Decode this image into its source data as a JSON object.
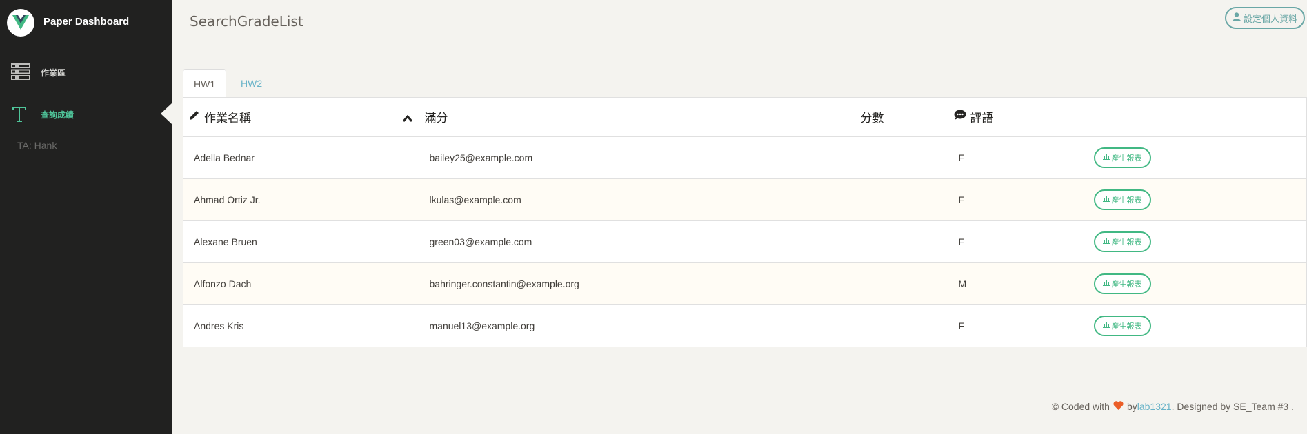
{
  "brand": {
    "name": "Paper Dashboard"
  },
  "sidebar": {
    "items": [
      {
        "label": "作業區",
        "icon": "list-icon",
        "active": false
      },
      {
        "label": "查詢成績",
        "icon": "text-t-icon",
        "active": true
      }
    ],
    "ta_label": "TA: Hank"
  },
  "header": {
    "title": "SearchGradeList",
    "profile_button": "設定個人資料"
  },
  "tabs": [
    {
      "label": "HW1",
      "active": true
    },
    {
      "label": "HW2",
      "active": false
    }
  ],
  "table": {
    "columns": [
      "作業名稱",
      "滿分",
      "分數",
      "評語",
      ""
    ],
    "rows": [
      {
        "name": "Adella Bednar",
        "email": "bailey25@example.com",
        "score": "",
        "comment": "F"
      },
      {
        "name": "Ahmad Ortiz Jr.",
        "email": "lkulas@example.com",
        "score": "",
        "comment": "F"
      },
      {
        "name": "Alexane Bruen",
        "email": "green03@example.com",
        "score": "",
        "comment": "F"
      },
      {
        "name": "Alfonzo Dach",
        "email": "bahringer.constantin@example.org",
        "score": "",
        "comment": "M"
      },
      {
        "name": "Andres Kris",
        "email": "manuel13@example.org",
        "score": "",
        "comment": "F"
      }
    ],
    "action_label": "產生報表"
  },
  "footer": {
    "prefix": "© Coded with",
    "by": "by",
    "author_link": "lab1321",
    "suffix": ". Designed by SE_Team #3 ."
  },
  "colors": {
    "accent": "#41b883",
    "link": "#68b3c8",
    "sidebar_bg": "#212120",
    "heart": "#eb5e28"
  }
}
